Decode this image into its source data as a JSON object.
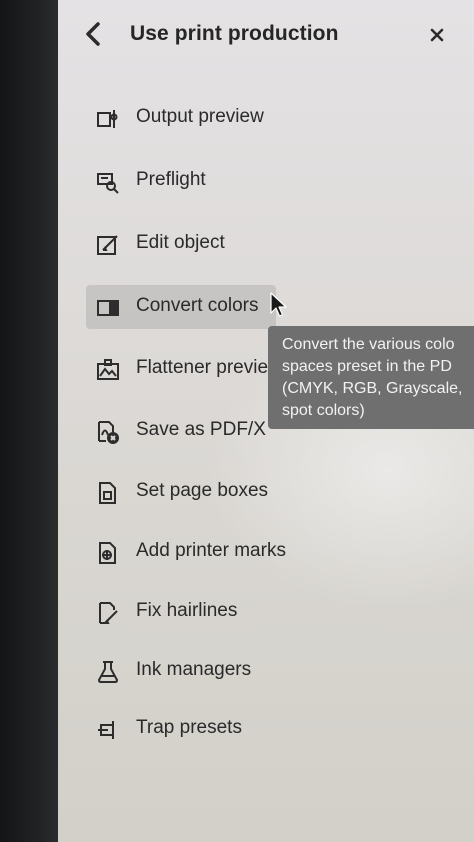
{
  "panel": {
    "title": "Use print production",
    "back_icon": "chevron-left-icon",
    "close_icon": "close-icon"
  },
  "menu": {
    "items": [
      {
        "label": "Output preview",
        "icon": "output-preview-icon"
      },
      {
        "label": "Preflight",
        "icon": "preflight-icon"
      },
      {
        "label": "Edit object",
        "icon": "edit-object-icon"
      },
      {
        "label": "Convert colors",
        "icon": "convert-colors-icon",
        "state": "hover"
      },
      {
        "label": "Flattener previe",
        "icon": "flattener-preview-icon"
      },
      {
        "label": "Save as PDF/X",
        "icon": "save-pdfx-icon"
      },
      {
        "label": "Set page boxes",
        "icon": "page-boxes-icon"
      },
      {
        "label": "Add printer marks",
        "icon": "printer-marks-icon"
      },
      {
        "label": "Fix hairlines",
        "icon": "fix-hairlines-icon"
      },
      {
        "label": "Ink managers",
        "icon": "ink-manager-icon"
      },
      {
        "label": "Trap presets",
        "icon": "trap-presets-icon"
      }
    ]
  },
  "tooltip": {
    "lines": [
      "Convert the various colo",
      "spaces preset in the PD",
      "(CMYK, RGB, Grayscale,",
      "spot colors)"
    ]
  },
  "colors": {
    "panel_bg": "#dcd9d6",
    "text": "#2a2a2a",
    "hover_bg": "#c6c4c2",
    "tooltip_bg": "#6f6f6f",
    "tooltip_text": "#f2f2f2"
  }
}
